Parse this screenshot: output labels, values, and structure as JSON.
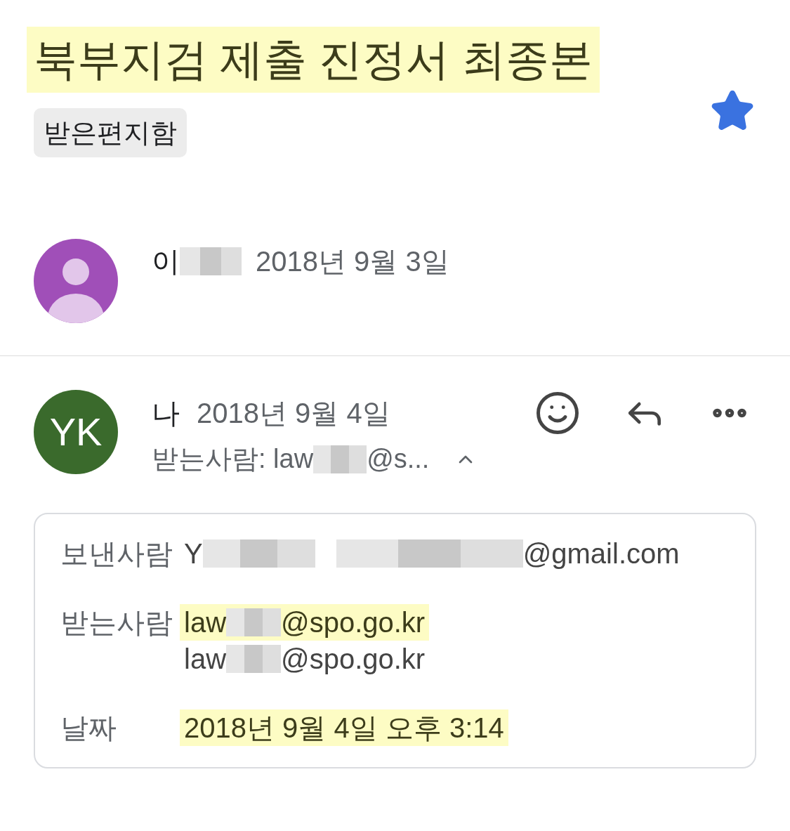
{
  "subject": {
    "text": "북부지검 제출 진정서 최종본",
    "highlighted": true
  },
  "label": "받은편지함",
  "starred": true,
  "messages": [
    {
      "kind": "collapsed",
      "avatar": {
        "kind": "person",
        "color": "#a04fb8"
      },
      "sender": "이",
      "sender_redacted": true,
      "date": "2018년 9월 3일"
    },
    {
      "kind": "expanded",
      "avatar": {
        "kind": "initials",
        "text": "YK",
        "color": "#3a6a2c"
      },
      "sender": "나",
      "date": "2018년 9월 4일",
      "to_prefix": "받는사람: law",
      "to_redacted": true,
      "to_suffix": "@s...",
      "details_expanded": true,
      "details": [
        {
          "label": "보낸사람",
          "lines": [
            {
              "before": "Y",
              "redacted": true,
              "after": "@gmail.com",
              "highlighted": false
            }
          ]
        },
        {
          "label": "받는사람",
          "lines": [
            {
              "before": "law",
              "redacted": true,
              "after": "@spo.go.kr",
              "highlighted": true
            },
            {
              "before": "law",
              "redacted": true,
              "after": "@spo.go.kr",
              "highlighted": false
            }
          ]
        },
        {
          "label": "날짜",
          "lines": [
            {
              "before": "2018년 9월 4일 오후 3:14",
              "highlighted": true
            }
          ]
        }
      ]
    }
  ]
}
